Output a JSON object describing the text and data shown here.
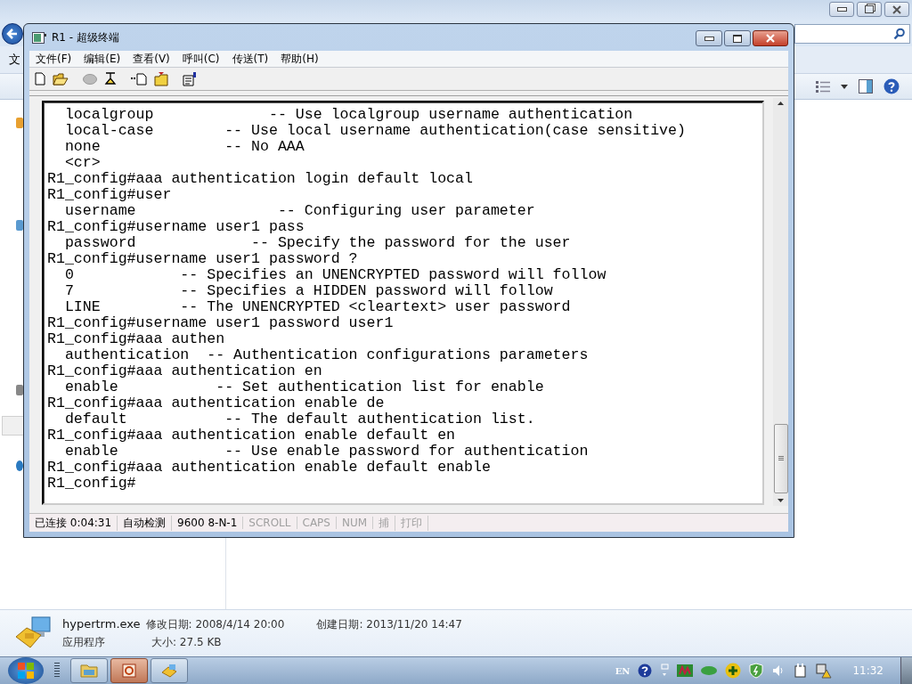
{
  "explorer": {
    "menu_fragment": "文"
  },
  "window": {
    "title": "R1 - 超级终端",
    "menu": [
      "文件(F)",
      "编辑(E)",
      "查看(V)",
      "呼叫(C)",
      "传送(T)",
      "帮助(H)"
    ],
    "terminal_lines": [
      "  localgroup             -- Use localgroup username authentication",
      "  local-case        -- Use local username authentication(case sensitive)",
      "  none              -- No AAA",
      "  <cr>",
      "R1_config#aaa authentication login default local",
      "R1_config#user",
      "  username                -- Configuring user parameter",
      "R1_config#username user1 pass",
      "  password             -- Specify the password for the user",
      "R1_config#username user1 password ?",
      "  0            -- Specifies an UNENCRYPTED password will follow",
      "  7            -- Specifies a HIDDEN password will follow",
      "  LINE         -- The UNENCRYPTED <cleartext> user password",
      "R1_config#username user1 password user1",
      "R1_config#aaa authen",
      "  authentication  -- Authentication configurations parameters",
      "R1_config#aaa authentication en",
      "  enable           -- Set authentication list for enable",
      "R1_config#aaa authentication enable de",
      "  default           -- The default authentication list.",
      "R1_config#aaa authentication enable default en",
      "  enable            -- Use enable password for authentication",
      "R1_config#aaa authentication enable default enable",
      "R1_config#"
    ],
    "status_bar": [
      {
        "text": "已连接 0:04:31",
        "active": true
      },
      {
        "text": "自动检测",
        "active": true
      },
      {
        "text": "9600 8-N-1",
        "active": true
      },
      {
        "text": "SCROLL",
        "active": false
      },
      {
        "text": "CAPS",
        "active": false
      },
      {
        "text": "NUM",
        "active": false
      },
      {
        "text": "捕",
        "active": false
      },
      {
        "text": "打印",
        "active": false
      }
    ]
  },
  "details": {
    "name": "hypertrm.exe",
    "modified": "修改日期: 2008/4/14 20:00",
    "created": "创建日期: 2013/11/20 14:47",
    "type": "应用程序",
    "size": "大小: 27.5 KB"
  },
  "taskbar": {
    "buttons": [
      {
        "kind": "folder",
        "selected": false
      },
      {
        "kind": "player",
        "selected": true
      },
      {
        "kind": "phone",
        "selected": false
      }
    ],
    "language": "EN",
    "clock": "11:32"
  }
}
